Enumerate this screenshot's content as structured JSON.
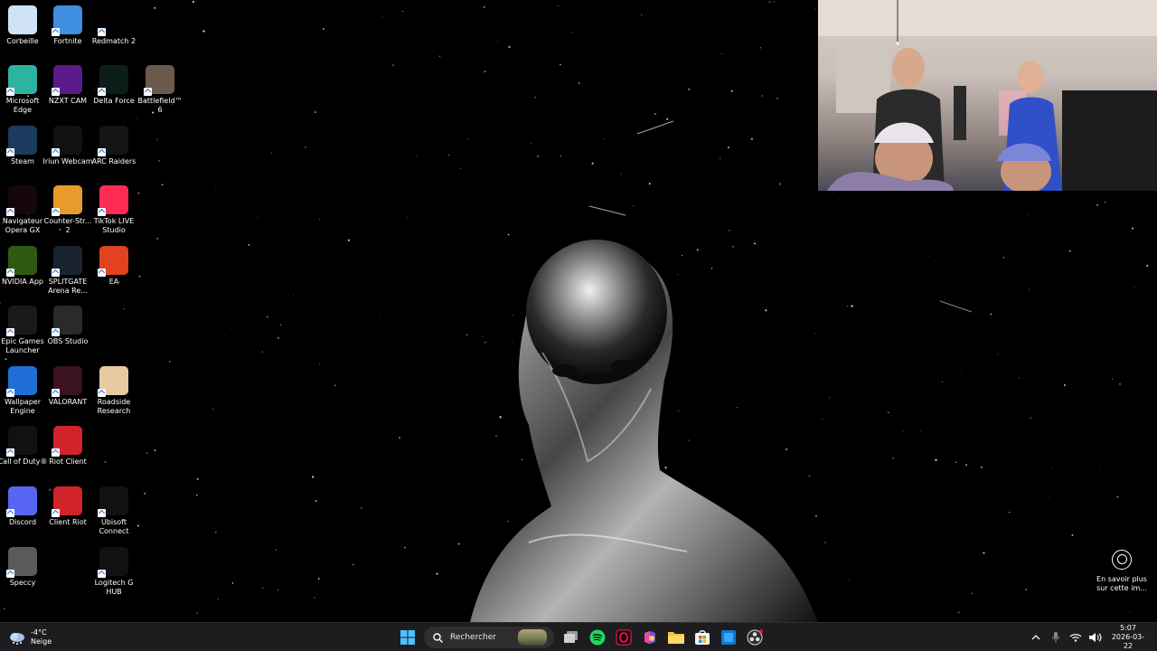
{
  "desktop_icons": [
    {
      "label": "Corbeille",
      "icon": "recycle-bin-icon",
      "color": "#cfe3f5",
      "shortcut": false,
      "col": 0,
      "row": 0
    },
    {
      "label": "Fortnite",
      "icon": "fortnite-icon",
      "color": "#3f8ee0",
      "shortcut": true,
      "col": 1,
      "row": 0
    },
    {
      "label": "Redmatch 2",
      "icon": "redmatch-icon",
      "color": "#000000",
      "shortcut": true,
      "col": 2,
      "row": 0
    },
    {
      "label": "Microsoft Edge",
      "icon": "edge-icon",
      "color": "#2bb5a0",
      "shortcut": true,
      "col": 0,
      "row": 1
    },
    {
      "label": "NZXT CAM",
      "icon": "nzxt-icon",
      "color": "#5b1a8c",
      "shortcut": true,
      "col": 1,
      "row": 1
    },
    {
      "label": "Delta Force",
      "icon": "delta-force-icon",
      "color": "#0c1e18",
      "shortcut": true,
      "col": 2,
      "row": 1
    },
    {
      "label": "Battlefield™ 6",
      "icon": "battlefield-icon",
      "color": "#6a5a4a",
      "shortcut": true,
      "col": 3,
      "row": 1
    },
    {
      "label": "Steam",
      "icon": "steam-icon",
      "color": "#1b3a5f",
      "shortcut": true,
      "col": 0,
      "row": 2
    },
    {
      "label": "Iriun Webcam",
      "icon": "webcam-icon",
      "color": "#111111",
      "shortcut": true,
      "col": 1,
      "row": 2
    },
    {
      "label": "ARC Raiders",
      "icon": "arc-raiders-icon",
      "color": "#151515",
      "shortcut": true,
      "col": 2,
      "row": 2
    },
    {
      "label": "Navigateur Opera GX",
      "icon": "opera-gx-icon",
      "color": "#16060a",
      "shortcut": true,
      "col": 0,
      "row": 3
    },
    {
      "label": "Counter-Str... 2",
      "icon": "counter-strike-icon",
      "color": "#e89a2a",
      "shortcut": true,
      "col": 1,
      "row": 3
    },
    {
      "label": "TikTok LIVE Studio",
      "icon": "tiktok-icon",
      "color": "#fe2c55",
      "shortcut": true,
      "col": 2,
      "row": 3
    },
    {
      "label": "NVIDIA App",
      "icon": "nvidia-icon",
      "color": "#2f5a12",
      "shortcut": true,
      "col": 0,
      "row": 4
    },
    {
      "label": "SPLITGATE Arena Re...",
      "icon": "splitgate-icon",
      "color": "#1a2430",
      "shortcut": true,
      "col": 1,
      "row": 4
    },
    {
      "label": "EA",
      "icon": "ea-icon",
      "color": "#e2421f",
      "shortcut": true,
      "col": 2,
      "row": 4
    },
    {
      "label": "Epic Games Launcher",
      "icon": "epic-games-icon",
      "color": "#1a1a1a",
      "shortcut": true,
      "col": 0,
      "row": 5
    },
    {
      "label": "OBS Studio",
      "icon": "obs-icon",
      "color": "#2a2a2a",
      "shortcut": true,
      "col": 1,
      "row": 5
    },
    {
      "label": "Wallpaper Engine",
      "icon": "wallpaper-engine-icon",
      "color": "#1f6fd6",
      "shortcut": true,
      "col": 0,
      "row": 6
    },
    {
      "label": "VALORANT",
      "icon": "valorant-icon",
      "color": "#3a1220",
      "shortcut": true,
      "col": 1,
      "row": 6
    },
    {
      "label": "Roadside Research",
      "icon": "roadside-research-icon",
      "color": "#e8c9a0",
      "shortcut": true,
      "col": 2,
      "row": 6
    },
    {
      "label": "Call of Duty®",
      "icon": "call-of-duty-icon",
      "color": "#111111",
      "shortcut": true,
      "col": 0,
      "row": 7
    },
    {
      "label": "Riot Client",
      "icon": "riot-client-icon",
      "color": "#d1232a",
      "shortcut": true,
      "col": 1,
      "row": 7
    },
    {
      "label": "Discord",
      "icon": "discord-icon",
      "color": "#5865f2",
      "shortcut": true,
      "col": 0,
      "row": 8
    },
    {
      "label": "Client Riot",
      "icon": "client-riot-icon",
      "color": "#d1232a",
      "shortcut": true,
      "col": 1,
      "row": 8
    },
    {
      "label": "Ubisoft Connect",
      "icon": "ubisoft-icon",
      "color": "#111111",
      "shortcut": true,
      "col": 2,
      "row": 8
    },
    {
      "label": "Speccy",
      "icon": "speccy-icon",
      "color": "#5a5a5a",
      "shortcut": true,
      "col": 0,
      "row": 9
    },
    {
      "label": "Logitech G HUB",
      "icon": "logitech-icon",
      "color": "#111111",
      "shortcut": true,
      "col": 2,
      "row": 9
    }
  ],
  "learn_more": {
    "label": "En savoir plus sur cette im..."
  },
  "taskbar": {
    "weather": {
      "temperature": "-4°C",
      "condition": "Neige"
    },
    "search_label": "Rechercher",
    "apps": [
      "file-explorer-icon",
      "spotify-icon",
      "opera-gx-icon",
      "copilot-icon",
      "folder-icon",
      "store-icon",
      "terminal-icon",
      "obs-icon"
    ],
    "clock": {
      "time": "5:07",
      "date": "2026-03-22"
    }
  },
  "colors": {
    "taskbar_bg": "#1d1d1f",
    "accent": "#0078d4",
    "spotify": "#1ed760"
  }
}
